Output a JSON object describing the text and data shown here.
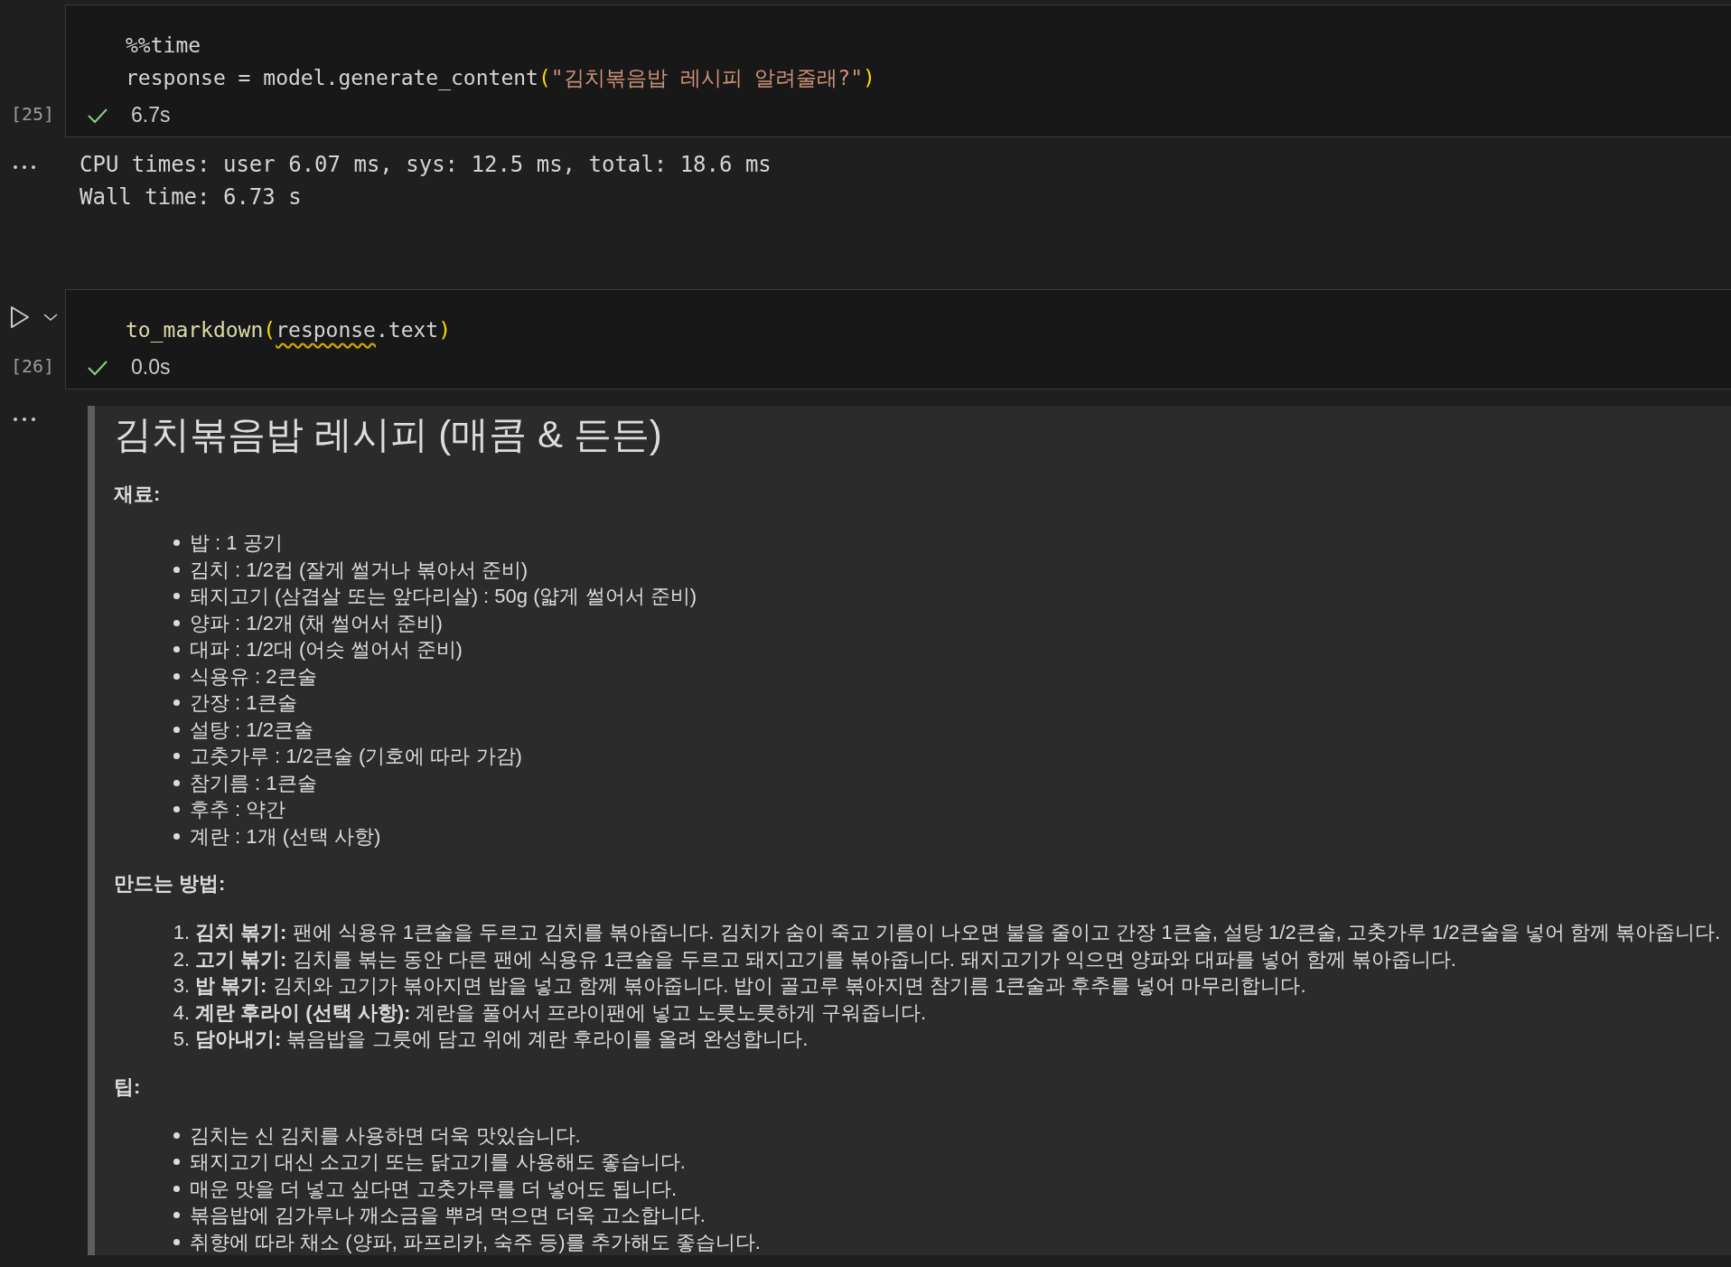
{
  "cells": [
    {
      "execution_count": "[25]",
      "run_controls": false,
      "code": [
        [
          {
            "kind": "plain",
            "text": "%%time"
          }
        ],
        [
          {
            "kind": "plain",
            "text": "response = model.generate_content"
          },
          {
            "kind": "paren",
            "text": "("
          },
          {
            "kind": "string",
            "text": "\"김치볶음밥 레시피 알려줄래?\""
          },
          {
            "kind": "paren",
            "text": ")"
          }
        ]
      ],
      "status": {
        "success": true,
        "duration": "6.7s"
      },
      "output": {
        "kind": "stream",
        "lines": [
          "CPU times: user 6.07 ms, sys: 12.5 ms, total: 18.6 ms",
          "Wall time: 6.73 s"
        ]
      }
    },
    {
      "execution_count": "[26]",
      "run_controls": true,
      "code": [
        [
          {
            "kind": "func",
            "text": "to_markdown"
          },
          {
            "kind": "paren",
            "text": "("
          },
          {
            "kind": "squiggle",
            "text": "response"
          },
          {
            "kind": "plain",
            "text": ".text"
          },
          {
            "kind": "paren",
            "text": ")"
          }
        ]
      ],
      "status": {
        "success": true,
        "duration": "0.0s"
      },
      "output": {
        "kind": "markdown",
        "title": "김치볶음밥 레시피 (매콤 & 든든)",
        "sections": [
          {
            "heading": "재료:",
            "kind": "bullet",
            "items": [
              "밥 : 1 공기",
              "김치 : 1/2컵 (잘게 썰거나 볶아서 준비)",
              "돼지고기 (삼겹살 또는 앞다리살) : 50g (얇게 썰어서 준비)",
              "양파 : 1/2개 (채 썰어서 준비)",
              "대파 : 1/2대 (어슷 썰어서 준비)",
              "식용유 : 2큰술",
              "간장 : 1큰술",
              "설탕 : 1/2큰술",
              "고춧가루 : 1/2큰술 (기호에 따라 가감)",
              "참기름 : 1큰술",
              "후추 : 약간",
              "계란 : 1개 (선택 사항)"
            ]
          },
          {
            "heading": "만드는 방법:",
            "kind": "ordered",
            "items": [
              {
                "number": "1.",
                "text": "**김치 볶기:** 팬에 식용유 1큰술을 두르고 김치를 볶아줍니다. 김치가 숨이 죽고 기름이 나오면 불을 줄이고 간장 1큰술, 설탕 1/2큰술, 고춧가루 1/2큰술을 넣어 함께 볶아줍니다."
              },
              {
                "number": "2.",
                "text": "**고기 볶기:** 김치를 볶는 동안 다른 팬에 식용유 1큰술을 두르고 돼지고기를 볶아줍니다. 돼지고기가 익으면 양파와 대파를 넣어 함께 볶아줍니다."
              },
              {
                "number": "3.",
                "text": "**밥 볶기:** 김치와 고기가 볶아지면 밥을 넣고 함께 볶아줍니다. 밥이 골고루 볶아지면 참기름 1큰술과 후추를 넣어 마무리합니다."
              },
              {
                "number": "4.",
                "text": "**계란 후라이 (선택 사항):** 계란을 풀어서 프라이팬에 넣고 노릇노릇하게 구워줍니다."
              },
              {
                "number": "5.",
                "text": "**담아내기:** 볶음밥을 그릇에 담고 위에 계란 후라이를 올려 완성합니다."
              }
            ]
          },
          {
            "heading": "팁:",
            "kind": "bullet",
            "items": [
              "김치는 신 김치를 사용하면 더욱 맛있습니다.",
              "돼지고기 대신 소고기 또는 닭고기를 사용해도 좋습니다.",
              "매운 맛을 더 넣고 싶다면 고춧가루를 더 넣어도 됩니다.",
              "볶음밥에 김가루나 깨소금을 뿌려 먹으면 더욱 고소합니다.",
              "취향에 따라 채소 (양파, 파프리카, 숙주 등)를 추가해도 좋습니다."
            ]
          }
        ]
      }
    }
  ]
}
